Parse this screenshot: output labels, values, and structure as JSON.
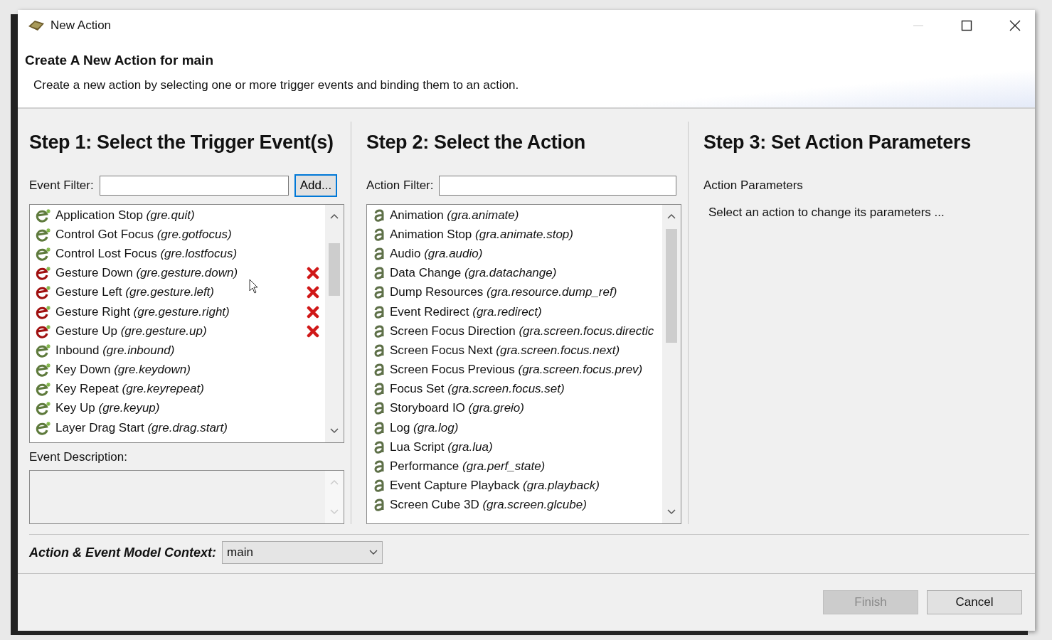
{
  "window": {
    "title": "New Action"
  },
  "header": {
    "title": "Create A New Action for main",
    "description": "Create a new action by selecting one or more trigger events and binding them to an action."
  },
  "step1": {
    "heading": "Step 1: Select the Trigger Event(s)",
    "filter_label": "Event Filter:",
    "add_button": {
      "label": "Add...",
      "focused": true
    },
    "events": [
      {
        "name": "Application Stop",
        "code": "(gre.quit)",
        "added": false
      },
      {
        "name": "Control Got Focus",
        "code": "(gre.gotfocus)",
        "added": false
      },
      {
        "name": "Control Lost Focus",
        "code": "(gre.lostfocus)",
        "added": false
      },
      {
        "name": "Gesture Down",
        "code": "(gre.gesture.down)",
        "added": true
      },
      {
        "name": "Gesture Left",
        "code": "(gre.gesture.left)",
        "added": true
      },
      {
        "name": "Gesture Right",
        "code": "(gre.gesture.right)",
        "added": true
      },
      {
        "name": "Gesture Up",
        "code": "(gre.gesture.up)",
        "added": true
      },
      {
        "name": "Inbound",
        "code": "(gre.inbound)",
        "added": false
      },
      {
        "name": "Key Down",
        "code": "(gre.keydown)",
        "added": false
      },
      {
        "name": "Key Repeat",
        "code": "(gre.keyrepeat)",
        "added": false
      },
      {
        "name": "Key Up",
        "code": "(gre.keyup)",
        "added": false
      },
      {
        "name": "Layer Drag Start",
        "code": "(gre.drag.start)",
        "added": false
      }
    ],
    "description_label": "Event Description:"
  },
  "step2": {
    "heading": "Step 2: Select the Action",
    "filter_label": "Action Filter:",
    "actions": [
      {
        "name": "Animation",
        "code": "(gra.animate)"
      },
      {
        "name": "Animation Stop",
        "code": "(gra.animate.stop)"
      },
      {
        "name": "Audio",
        "code": "(gra.audio)"
      },
      {
        "name": "Data Change",
        "code": "(gra.datachange)"
      },
      {
        "name": "Dump Resources",
        "code": "(gra.resource.dump_ref)"
      },
      {
        "name": "Event Redirect",
        "code": "(gra.redirect)"
      },
      {
        "name": "Screen Focus Direction",
        "code": "(gra.screen.focus.directic"
      },
      {
        "name": "Screen Focus Next",
        "code": "(gra.screen.focus.next)"
      },
      {
        "name": "Screen Focus Previous",
        "code": "(gra.screen.focus.prev)"
      },
      {
        "name": "Focus Set",
        "code": "(gra.screen.focus.set)"
      },
      {
        "name": "Storyboard IO",
        "code": "(gra.greio)"
      },
      {
        "name": "Log",
        "code": "(gra.log)"
      },
      {
        "name": "Lua Script",
        "code": "(gra.lua)"
      },
      {
        "name": "Performance",
        "code": "(gra.perf_state)"
      },
      {
        "name": "Event Capture Playback",
        "code": "(gra.playback)"
      },
      {
        "name": "Screen Cube 3D",
        "code": "(gra.screen.glcube)"
      }
    ]
  },
  "step3": {
    "heading": "Step 3: Set Action Parameters",
    "section_label": "Action Parameters",
    "hint": "Select an action to change its parameters ..."
  },
  "context": {
    "label": "Action & Event Model Context:",
    "value": "main"
  },
  "buttons": [
    {
      "label": "Finish",
      "disabled": true
    },
    {
      "label": "Cancel",
      "disabled": false
    }
  ]
}
